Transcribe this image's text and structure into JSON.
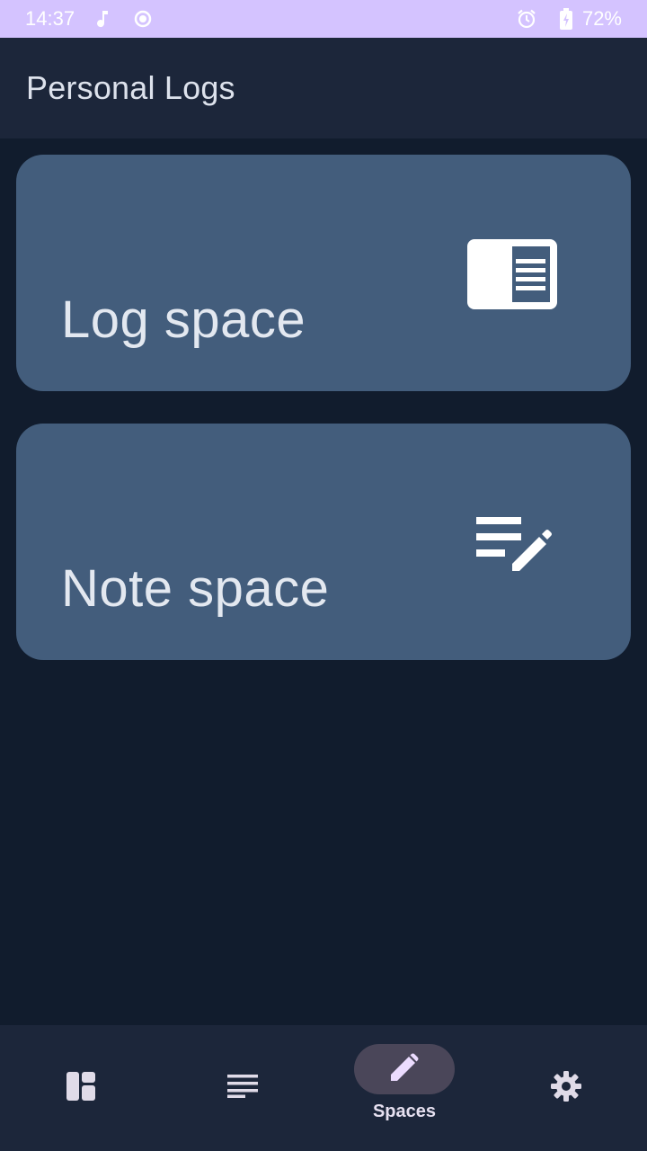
{
  "status_bar": {
    "time": "14:37",
    "battery": "72%",
    "icons": [
      "music-note-icon",
      "record-icon",
      "alarm-icon",
      "battery-charging-icon"
    ]
  },
  "app_bar": {
    "title": "Personal Logs"
  },
  "cards": [
    {
      "label": "Log space",
      "icon": "log-book-icon"
    },
    {
      "label": "Note space",
      "icon": "edit-note-icon"
    }
  ],
  "bottom_nav": {
    "items": [
      {
        "label": "",
        "icon": "dashboard-icon",
        "active": false
      },
      {
        "label": "",
        "icon": "notes-list-icon",
        "active": false
      },
      {
        "label": "Spaces",
        "icon": "pencil-icon",
        "active": true
      },
      {
        "label": "",
        "icon": "settings-gear-icon",
        "active": false
      }
    ]
  },
  "colors": {
    "status_bar_bg": "#d4c3ff",
    "app_bar_bg": "#1c263a",
    "background": "#111c2d",
    "card_bg": "#435d7c",
    "active_pill": "#4a4659"
  }
}
